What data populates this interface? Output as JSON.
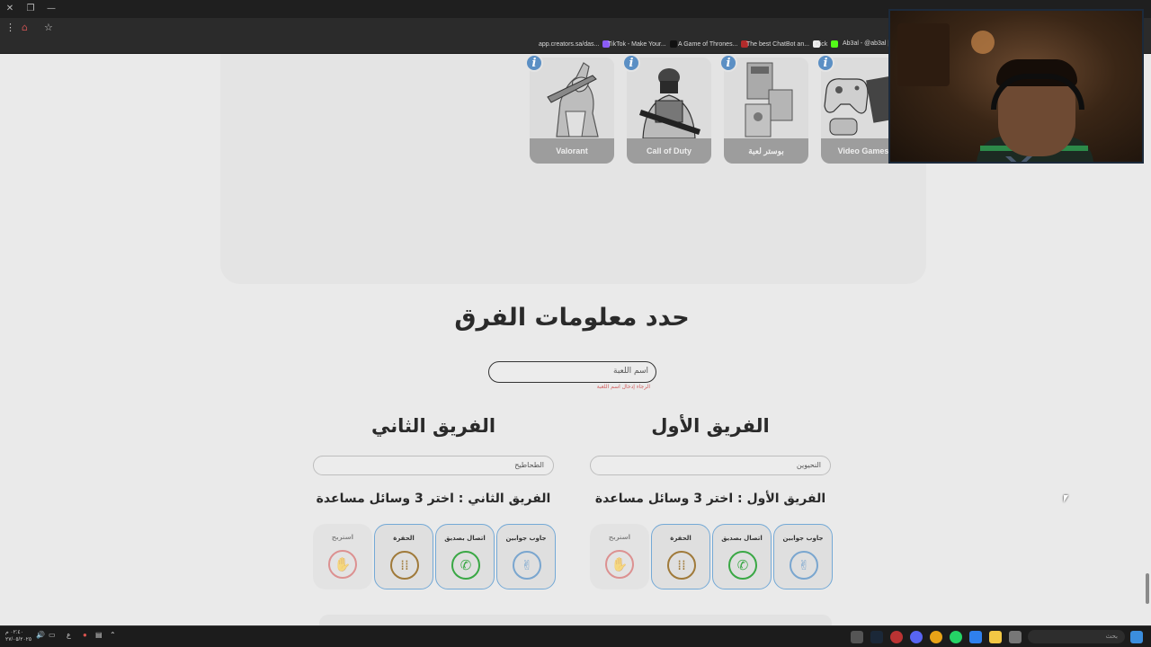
{
  "browser": {
    "bookmarks": [
      {
        "label": "app.creators.sa/das...",
        "color": "#8a5cf6"
      },
      {
        "label": "TikTok - Make Your...",
        "color": "#111111"
      },
      {
        "label": "A Game of Thrones...",
        "color": "#b22b2b"
      },
      {
        "label": "The best ChatBot an...",
        "color": "#eeeeee"
      },
      {
        "label": "Kick",
        "color": "#53fc18"
      },
      {
        "label": "Ab3al - @ab3al |",
        "color": "#888888"
      }
    ]
  },
  "games": [
    {
      "label": "Valorant",
      "info": "i"
    },
    {
      "label": "Call of Duty",
      "info": "i"
    },
    {
      "label": "بوستر لعبة",
      "info": "i"
    },
    {
      "label": "Video Games",
      "info": "i"
    }
  ],
  "section": {
    "title": "حدد معلومات الفرق",
    "game_input_value": "اسم اللعبة",
    "error": "الرجاء إدخال اسم اللعبة"
  },
  "team_one": {
    "title": "الفريق الأول",
    "name_value": "النحيوين",
    "help_title": "الفريق الأول : اختر 3 وسائل مساعدة",
    "helps": [
      {
        "label": "جاوب جوابين",
        "icon": "peace-hand-icon",
        "color": "#7aa6cf",
        "selected": true
      },
      {
        "label": "اتصال بصديق",
        "icon": "phone-icon",
        "color": "#3aa845",
        "selected": true
      },
      {
        "label": "الحفرة",
        "icon": "footprints-icon",
        "color": "#a07a3a",
        "selected": true
      },
      {
        "label": "استريح",
        "icon": "stop-hand-icon",
        "color": "#d14a4a",
        "selected": false
      }
    ]
  },
  "team_two": {
    "title": "الفريق الثاني",
    "name_value": "الطحاطيح",
    "help_title": "الفريق الثاني : اختر 3 وسائل مساعدة",
    "helps": [
      {
        "label": "جاوب جوابين",
        "icon": "peace-hand-icon",
        "color": "#7aa6cf",
        "selected": true
      },
      {
        "label": "اتصال بصديق",
        "icon": "phone-icon",
        "color": "#3aa845",
        "selected": true
      },
      {
        "label": "الحفرة",
        "icon": "footprints-icon",
        "color": "#a07a3a",
        "selected": true
      },
      {
        "label": "استريح",
        "icon": "stop-hand-icon",
        "color": "#d14a4a",
        "selected": false
      }
    ]
  },
  "taskbar": {
    "clock_time": "٠٢:٤٠ م",
    "clock_date": "٢٧/٠٥/٢٠٢٥",
    "lang": "ع",
    "search_placeholder": "بحث"
  }
}
